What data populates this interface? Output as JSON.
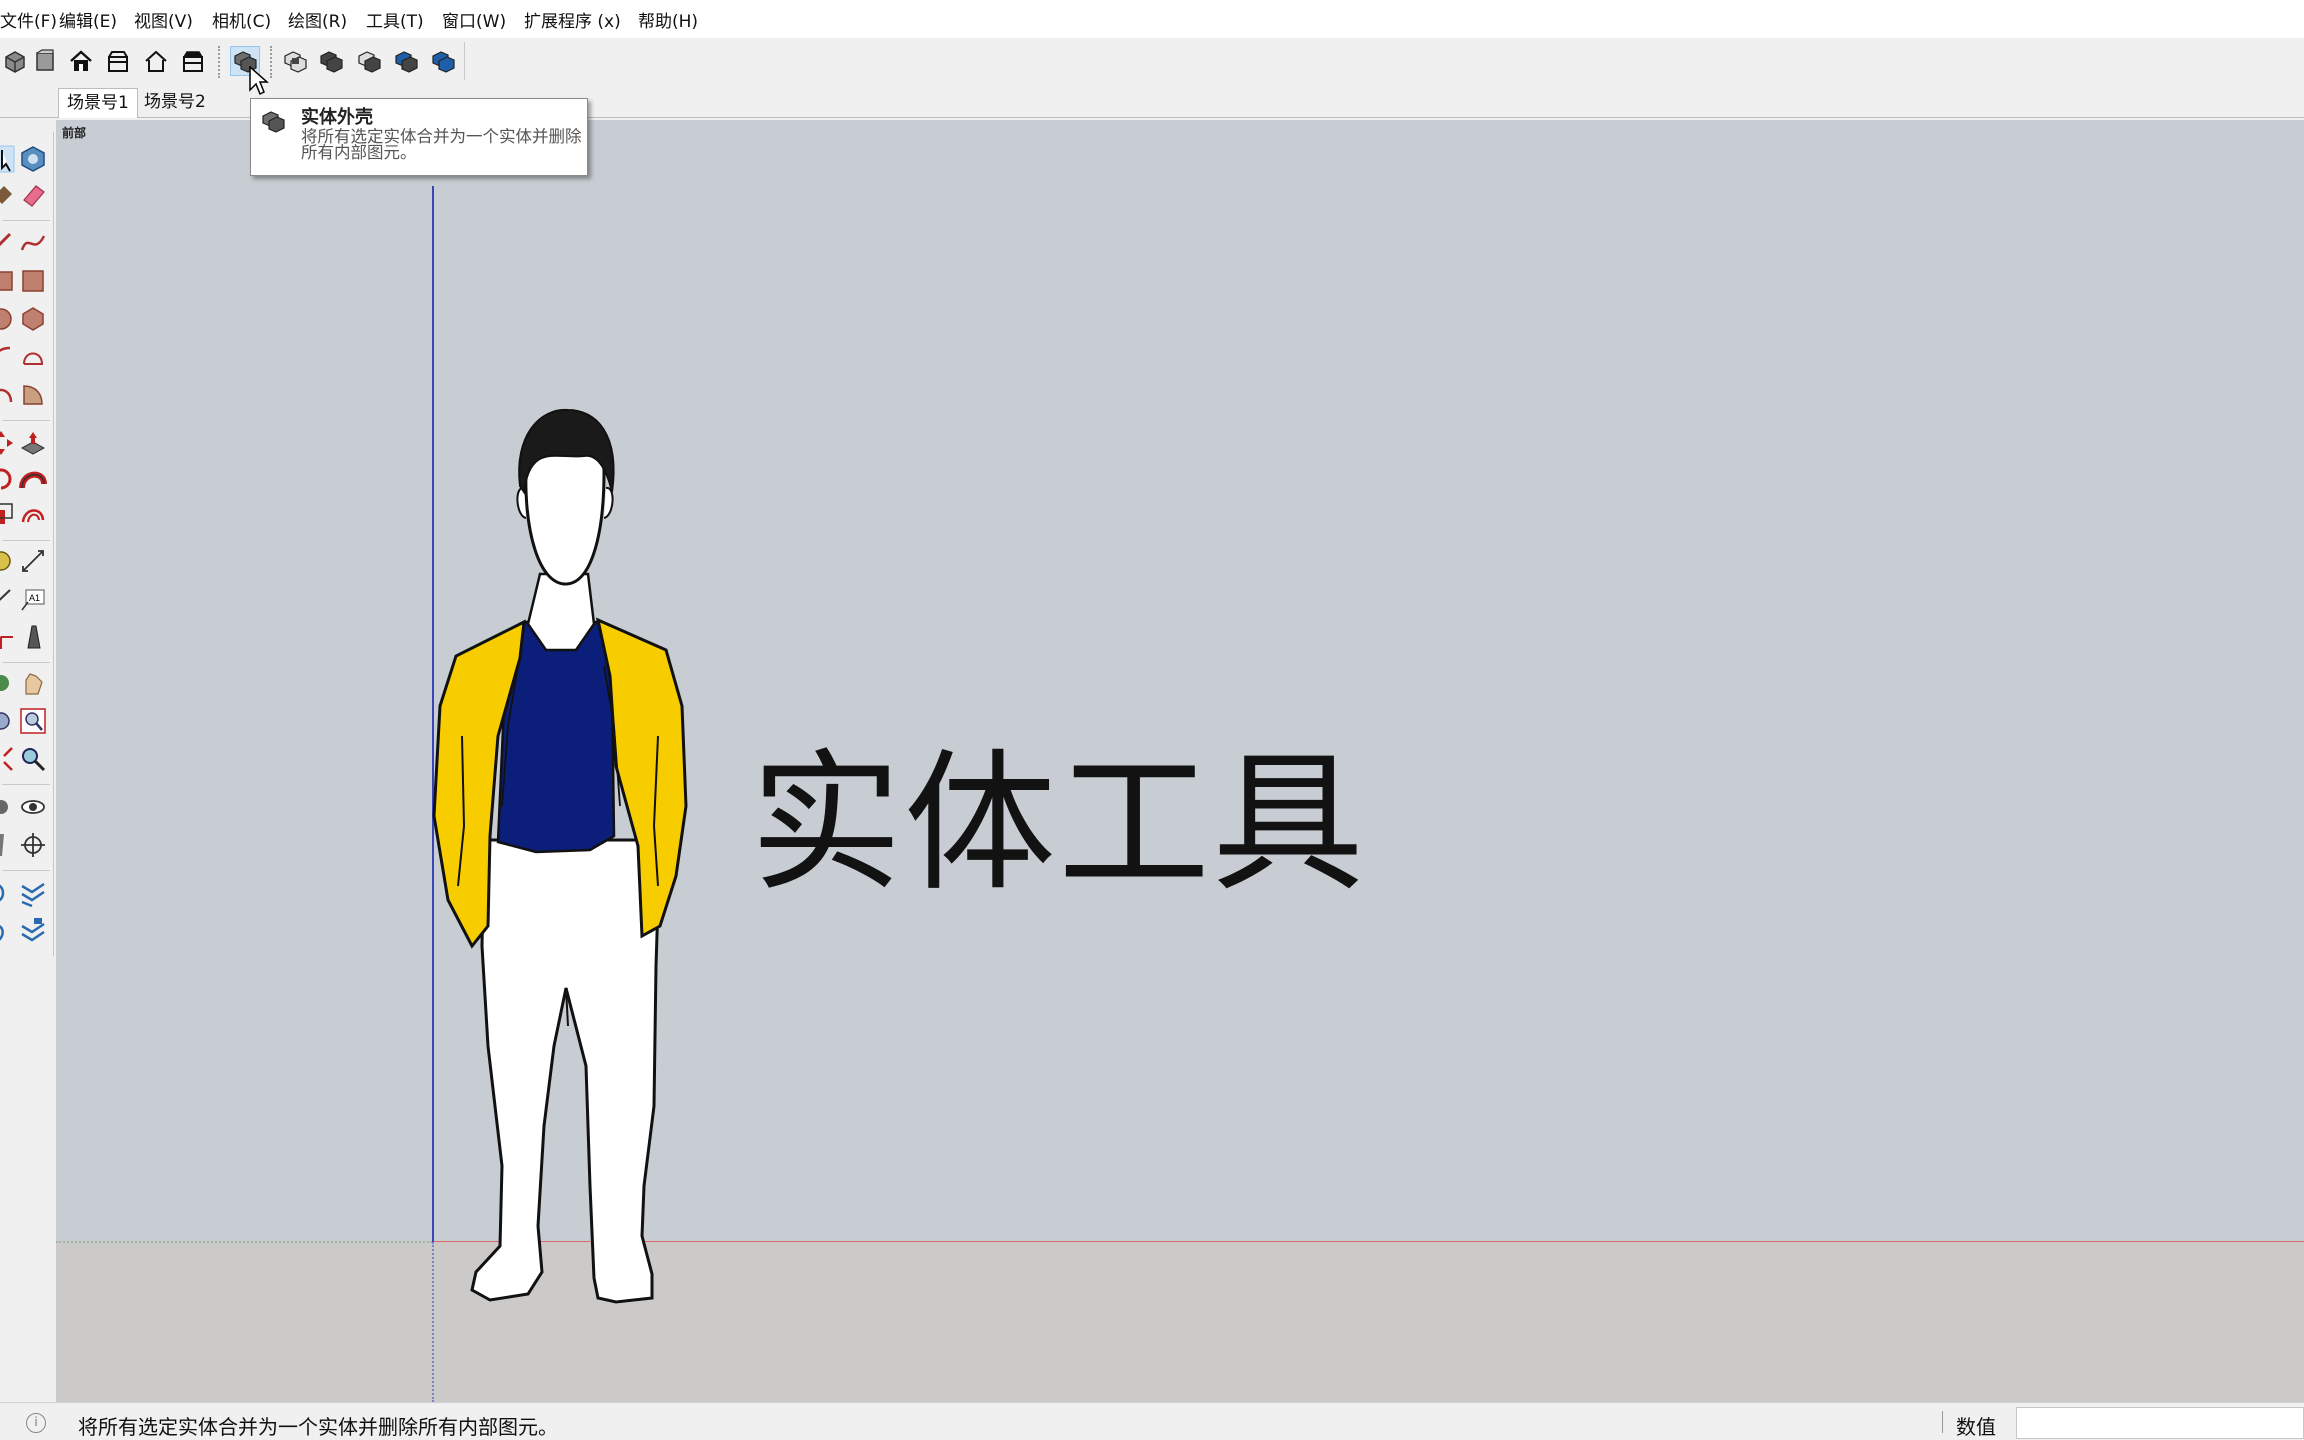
{
  "menu": {
    "items": [
      "文件(F)",
      "编辑(E)",
      "视图(V)",
      "相机(C)",
      "绘图(R)",
      "工具(T)",
      "窗口(W)",
      "扩展程序 (x)",
      "帮助(H)"
    ]
  },
  "toolbar": {
    "views_icons": [
      "iso-view-icon",
      "top-view-icon",
      "front-view-icon",
      "right-view-icon",
      "back-view-icon",
      "left-view-icon"
    ],
    "solid_tools_icons": [
      "outer-shell-icon",
      "intersect-icon",
      "union-icon",
      "subtract-icon",
      "trim-icon",
      "split-icon"
    ]
  },
  "scenes": {
    "tabs": [
      "场景号1",
      "场景号2"
    ]
  },
  "viewport": {
    "camera_label": "前部",
    "title_text": "实体工具",
    "colors": {
      "sky": "#c7cdd2",
      "ground": "#cbcac8",
      "jacket": "#f7cd00",
      "shirt": "#0b1f7a",
      "pants": "#ffffff",
      "hair": "#1a1a1a"
    }
  },
  "tooltip": {
    "title": "实体外壳",
    "description": "将所有选定实体合并为一个实体并删除所有内部图元。"
  },
  "status": {
    "message": "将所有选定实体合并为一个实体并删除所有内部图元。",
    "measure_label": "数值",
    "measure_value": ""
  }
}
